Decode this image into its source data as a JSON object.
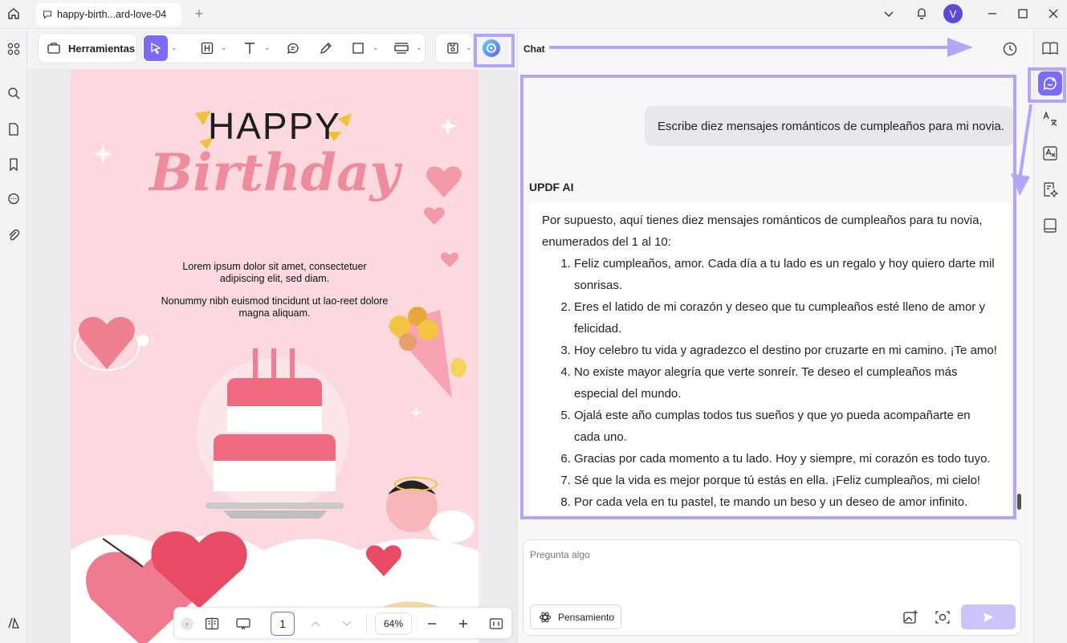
{
  "titlebar": {
    "tab_title": "happy-birth...ard-love-04",
    "avatar_letter": "V"
  },
  "toolbar": {
    "tools_label": "Herramientas"
  },
  "page": {
    "happy": "HAPPY",
    "birthday": "Birthday",
    "paragraph1": "Lorem ipsum dolor sit amet, consectetuer adipiscing elit, sed diam.",
    "paragraph2": "Nonummy nibh euismod tincidunt ut lao-reet dolore magna aliquam."
  },
  "bottombar": {
    "page_number": "1",
    "zoom": "64%"
  },
  "chat": {
    "title": "Chat",
    "user_message": "Escribe diez mensajes románticos de cumpleaños para mi novia.",
    "ai_name": "UPDF AI",
    "ai_intro": "Por supuesto, aquí tienes diez mensajes románticos de cumpleaños para tu novia, enumerados del 1 al 10:",
    "ai_items": [
      "Feliz cumpleaños, amor. Cada día a tu lado es un regalo y hoy quiero darte mil sonrisas.",
      "Eres el latido de mi corazón y deseo que tu cumpleaños esté lleno de amor y felicidad.",
      "Hoy celebro tu vida y agradezco el destino por cruzarte en mi camino. ¡Te amo!",
      "No existe mayor alegría que verte sonreír. Te deseo el cumpleaños más especial del mundo.",
      "Ojalá este año cumplas todos tus sueños y que yo pueda acompañarte en cada uno.",
      "Gracias por cada momento a tu lado. Hoy y siempre, mi corazón es todo tuyo.",
      "Sé que la vida es mejor porque tú estás en ella. ¡Feliz cumpleaños, mi cielo!",
      "Por cada vela en tu pastel, te mando un beso y un deseo de amor infinito."
    ],
    "input_placeholder": "Pregunta algo",
    "thinking_label": "Pensamiento"
  },
  "colors": {
    "accent": "#7b6cf6",
    "highlight": "#b4a6f6",
    "page_pink": "#fbd9de"
  }
}
